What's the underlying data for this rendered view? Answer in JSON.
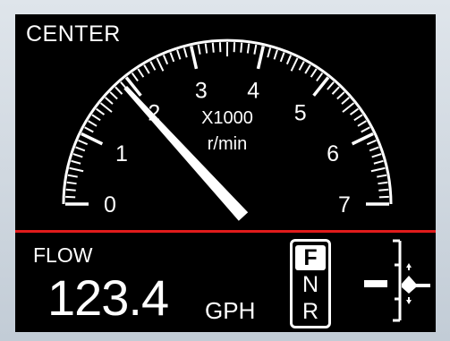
{
  "center_label": "CENTER",
  "tach": {
    "multiplier": "X1000",
    "unit": "r/min",
    "scale_labels": [
      "0",
      "1",
      "2",
      "3",
      "4",
      "5",
      "6",
      "7"
    ],
    "needle_value": 1.9,
    "max": 7
  },
  "flow": {
    "label": "FLOW",
    "value": "123.4",
    "unit": "GPH"
  },
  "gear": {
    "items": [
      "F",
      "N",
      "R"
    ],
    "selected": "F"
  },
  "colors": {
    "redline": "#e01b1b",
    "foreground": "#ffffff",
    "background": "#000000"
  },
  "icons": {
    "trim": "trim-indicator-icon"
  }
}
